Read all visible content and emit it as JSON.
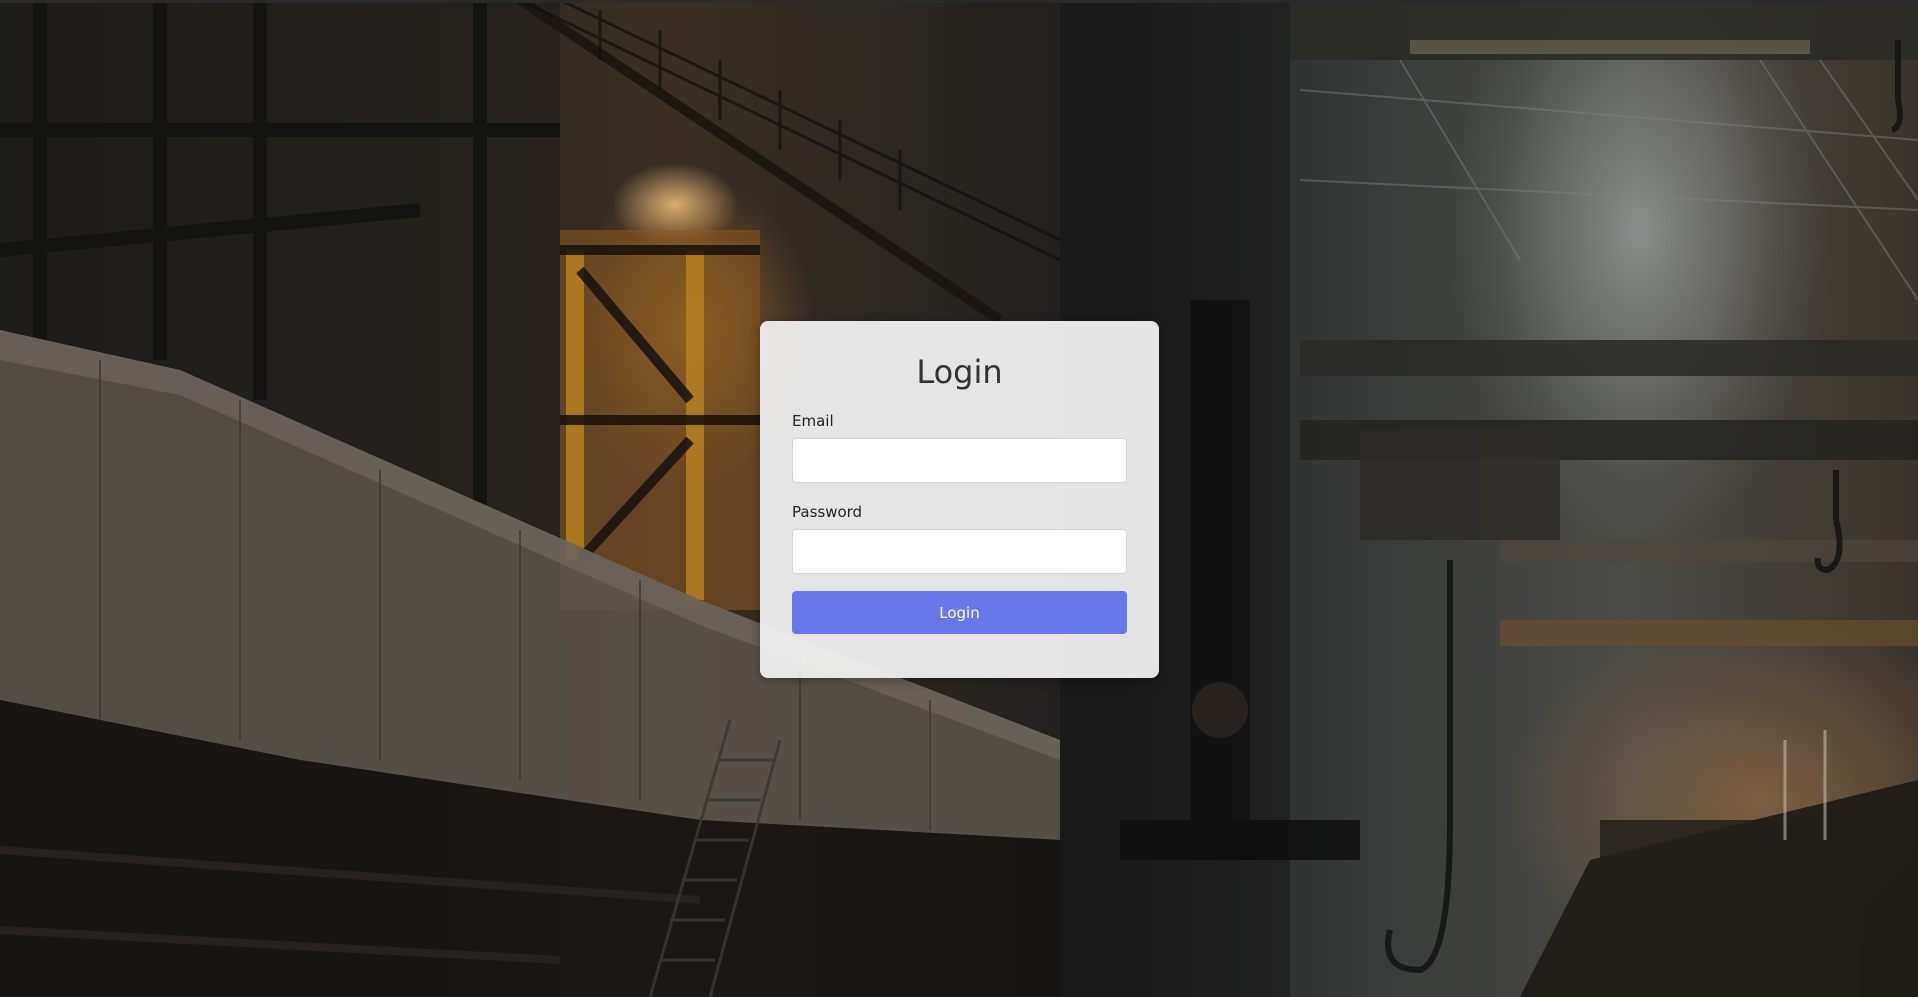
{
  "login": {
    "title": "Login",
    "email_label": "Email",
    "email_value": "",
    "password_label": "Password",
    "password_value": "",
    "submit_label": "Login"
  },
  "theme": {
    "accent": "#6778ea",
    "card_background": "#f1f1f1"
  },
  "background": {
    "icon": "industrial-foundry-photo"
  }
}
